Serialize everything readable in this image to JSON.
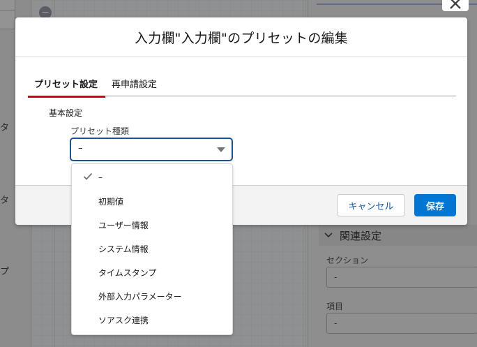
{
  "background": {
    "left_peek_texts": [
      "タ",
      "タ",
      "プ"
    ],
    "related_section_label": "関連設定",
    "section_field_label": "セクション",
    "section_field_value": "-",
    "item_field_label": "項目",
    "item_field_value": "-"
  },
  "modal": {
    "title": "入力欄\"入力欄\"のプリセットの編集",
    "tabs": [
      {
        "label": "プリセット設定",
        "active": true
      },
      {
        "label": "再申請設定",
        "active": false
      }
    ],
    "section_label": "基本設定",
    "preset_type_label": "プリセット種類",
    "preset_type_value": "–",
    "cancel_label": "キャンセル",
    "save_label": "保存"
  },
  "dropdown": {
    "options": [
      {
        "label": "–",
        "selected": true
      },
      {
        "label": "初期値",
        "selected": false
      },
      {
        "label": "ユーザー情報",
        "selected": false
      },
      {
        "label": "システム情報",
        "selected": false
      },
      {
        "label": "タイムスタンプ",
        "selected": false
      },
      {
        "label": "外部入力パラメーター",
        "selected": false
      },
      {
        "label": "ソアスク連携",
        "selected": false
      }
    ]
  },
  "icons": {
    "check": "check-icon",
    "chevron": "chevron-down-icon",
    "close": "close-icon",
    "collapse": "minus-circle-icon"
  },
  "colors": {
    "brand_blue": "#0176d3",
    "active_tab_underline": "#d0021b",
    "focus_border": "#1b5297"
  }
}
